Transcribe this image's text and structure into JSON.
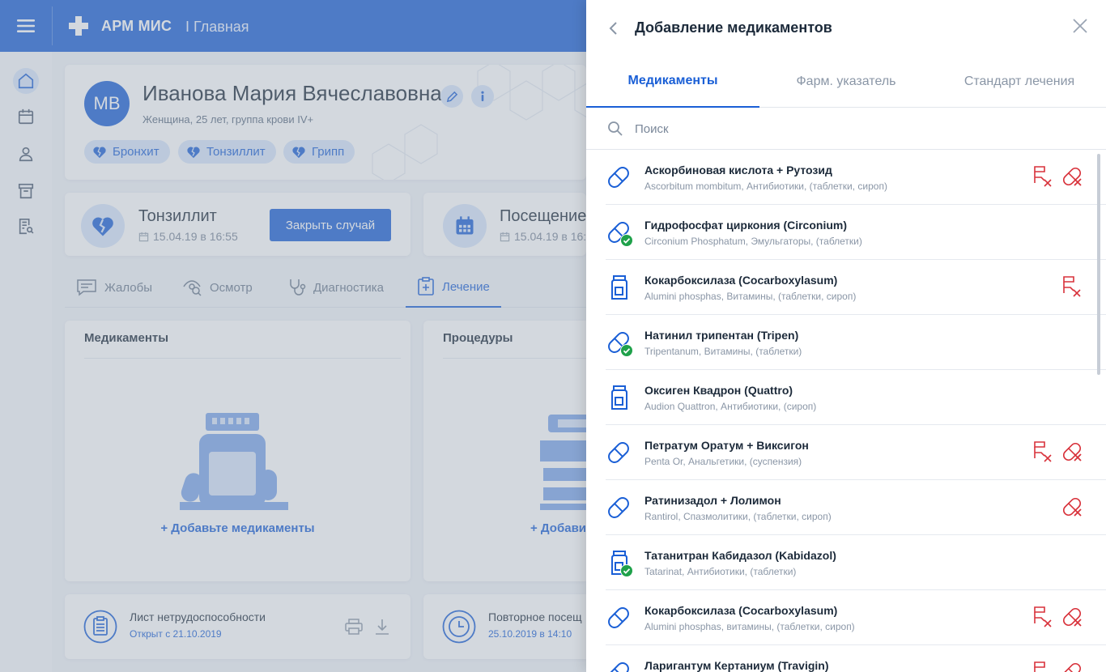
{
  "header": {
    "app_name": "АРМ МИС",
    "breadcrumb": "I Главная"
  },
  "patient": {
    "initials": "МВ",
    "name": "Иванова Мария Вячеславовна",
    "meta": "Женщина, 25 лет, группа крови IV+",
    "tags": [
      "Бронхит",
      "Тонзиллит",
      "Грипп"
    ]
  },
  "case_card": {
    "title": "Тонзиллит",
    "date": "15.04.19 в 16:55",
    "close_label": "Закрыть случай"
  },
  "visit_card": {
    "title": "Посещение",
    "date": "15.04.19 в 16:"
  },
  "tabs": [
    "Жалобы",
    "Осмотр",
    "Диагностика",
    "Лечение"
  ],
  "medications_section": {
    "title": "Медикаменты",
    "add_label": "+ Добавьте медикаменты"
  },
  "procedures_section": {
    "title": "Процедуры",
    "add_label": "+ Добавит"
  },
  "sick_leave": {
    "title": "Лист нетрудоспособности",
    "subtitle": "Открыт с 21.10.2019"
  },
  "repeat_visit": {
    "title": "Повторное посещ",
    "subtitle": "25.10.2019 в 14:10"
  },
  "panel": {
    "title": "Добавление медикаментов",
    "tabs": [
      "Медикаменты",
      "Фарм. указатель",
      "Стандарт лечения"
    ],
    "search_placeholder": "Поиск",
    "items": [
      {
        "name": "Аскорбиновая кислота + Рутозид",
        "sub": "Ascorbitum mombitum, Антибиотики, (таблетки, сироп)",
        "icon": "pill-icon",
        "check": false,
        "rx": true,
        "nopill": true
      },
      {
        "name": "Гидрофосфат циркония (Circonium)",
        "sub": "Circonium Phosphatum, Эмульгаторы, (таблетки)",
        "icon": "pill-icon",
        "check": true,
        "rx": false,
        "nopill": false
      },
      {
        "name": "Кокарбоксилаза (Cocarboxylasum)",
        "sub": "Alumini phosphas, Витамины, (таблетки, сироп)",
        "icon": "bottle-icon",
        "check": false,
        "rx": true,
        "nopill": false
      },
      {
        "name": "Натинил трипентан (Tripen)",
        "sub": "Tripentanum, Витамины, (таблетки)",
        "icon": "pill-icon",
        "check": true,
        "rx": false,
        "nopill": false
      },
      {
        "name": "Оксиген Квадрон (Quattro)",
        "sub": "Audion Quattron, Антибиотики, (сироп)",
        "icon": "bottle-icon",
        "check": false,
        "rx": false,
        "nopill": false
      },
      {
        "name": "Петратум Оратум + Виксигон",
        "sub": "Penta Or, Анальгетики, (суспензия)",
        "icon": "pill-icon",
        "check": false,
        "rx": true,
        "nopill": true
      },
      {
        "name": "Ратинизадол + Лолимон",
        "sub": "Rantirol, Спазмолитики, (таблетки, сироп)",
        "icon": "pill-icon",
        "check": false,
        "rx": false,
        "nopill": true
      },
      {
        "name": "Татанитран Кабидазол (Kabidazol)",
        "sub": "Tatarinat, Антибиотики, (таблетки)",
        "icon": "bottle-icon",
        "check": true,
        "rx": false,
        "nopill": false
      },
      {
        "name": "Кокарбоксилаза (Cocarboxylasum)",
        "sub": "Alumini phosphas, витамины, (таблетки, сироп)",
        "icon": "pill-icon",
        "check": false,
        "rx": true,
        "nopill": true
      },
      {
        "name": "Ларигантум Кертаниум (Travigin)",
        "sub": "",
        "icon": "pill-icon",
        "check": false,
        "rx": true,
        "nopill": true
      }
    ]
  },
  "colors": {
    "primary": "#1a5fd6",
    "light": "#d7e6fb",
    "danger": "#d8323b",
    "success": "#1fa14a"
  }
}
